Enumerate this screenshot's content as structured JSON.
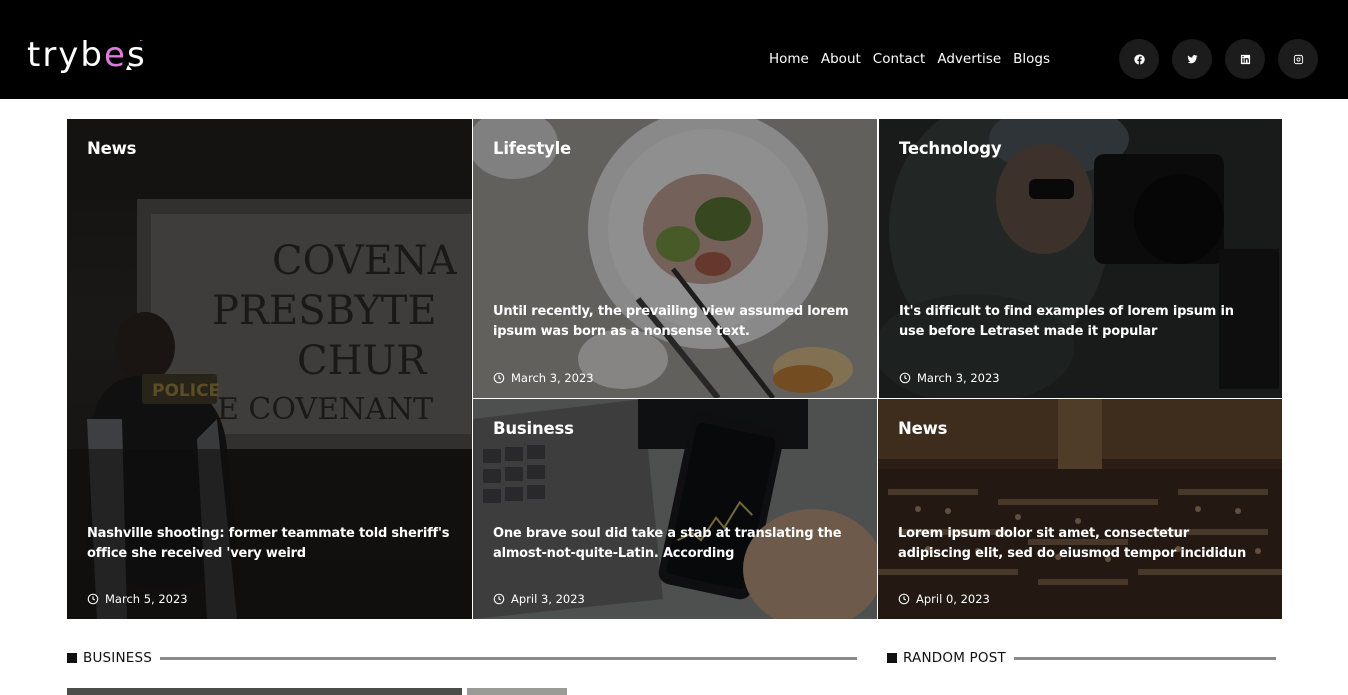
{
  "brand": {
    "logo_part1": "tryb",
    "logo_accent": "e",
    "logo_part2": "s"
  },
  "nav": {
    "items": [
      "Home",
      "About",
      "Contact",
      "Advertise",
      "Blogs"
    ]
  },
  "social": [
    "facebook-icon",
    "twitter-icon",
    "linkedin-icon",
    "instagram-icon"
  ],
  "featured": [
    {
      "category": "News",
      "title": "Nashville shooting: former teammate told sheriff's office she received 'very weird",
      "date": "March 5, 2023"
    },
    {
      "category": "Lifestyle",
      "title": "Until recently, the prevailing view assumed lorem ipsum was born as a nonsense text.",
      "date": "March 3, 2023"
    },
    {
      "category": "Technology",
      "title": "It's difficult to find examples of lorem ipsum in use before Letraset made it popular",
      "date": "March 3, 2023"
    },
    {
      "category": "Business",
      "title": "One brave soul did take a stab at translating the almost-not-quite-Latin. According",
      "date": "April 3, 2023"
    },
    {
      "category": "News",
      "title": "Lorem ipsum dolor sit amet, consectetur adipiscing elit, sed do eiusmod tempor incididun",
      "date": "April 0, 2023"
    }
  ],
  "sections": {
    "business": "BUSINESS",
    "random": "RANDOM POST"
  },
  "colors": {
    "header_bg": "#000000",
    "accent": "#e07bd9"
  }
}
